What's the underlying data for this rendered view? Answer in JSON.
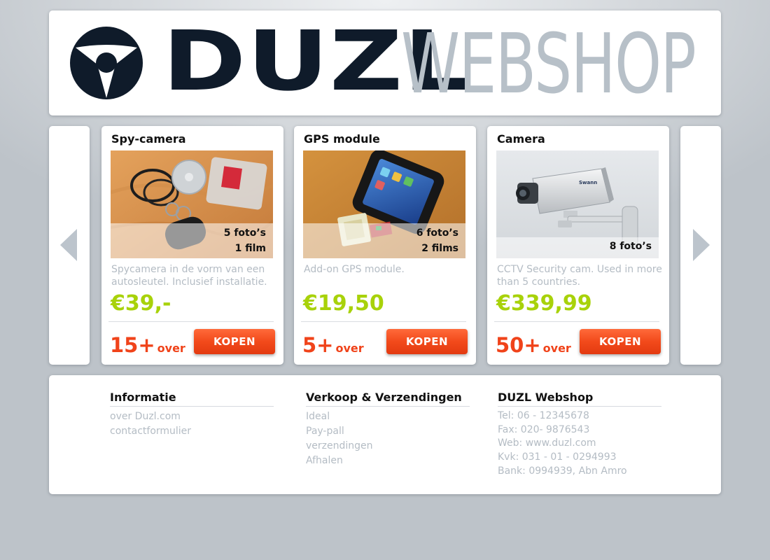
{
  "header": {
    "logo_duzl": "DUZL",
    "logo_webshop": "WEBSHOP",
    "logo_color": "#0f1b2a",
    "logo_secondary_color": "#b7c0c8"
  },
  "carousel": {
    "prev_icon": "chevron-left-icon",
    "next_icon": "chevron-right-icon"
  },
  "products": [
    {
      "title": "Spy-camera",
      "photos": "5 foto’s",
      "films": "1 film",
      "description": "Spycamera in de vorm van een autosleutel. Inclusief installatie.",
      "price": "€39,-",
      "stock_count": "15+",
      "stock_label": "over",
      "buy_label": "KOPEN"
    },
    {
      "title": "GPS module",
      "photos": "6 foto’s",
      "films": "2 films",
      "description": "Add-on GPS module.",
      "price": "€19,50",
      "stock_count": "5+",
      "stock_label": "over",
      "buy_label": "KOPEN"
    },
    {
      "title": "Camera",
      "photos": "8 foto’s",
      "description": "CCTV Security cam. Used in more than 5 countries.",
      "price": "€339,99",
      "stock_count": "50+",
      "stock_label": "over",
      "buy_label": "KOPEN"
    }
  ],
  "footer": {
    "info": {
      "heading": "Informatie",
      "links": [
        "over Duzl.com",
        "contactformulier"
      ]
    },
    "sales": {
      "heading": "Verkoop & Verzendingen",
      "links": [
        "Ideal",
        "Pay-pall",
        "verzendingen",
        "Afhalen"
      ]
    },
    "company": {
      "heading": "DUZL Webshop",
      "lines": [
        "Tel: 06 - 12345678",
        "Fax: 020- 9876543",
        "Web: www.duzl.com",
        "Kvk: 031 - 01 - 0294993",
        "Bank: 0994939, Abn Amro"
      ]
    }
  },
  "colors": {
    "price": "#a8d20a",
    "stock": "#f0431a",
    "button": "#f24a1b",
    "muted_text": "#b4bcc4"
  }
}
